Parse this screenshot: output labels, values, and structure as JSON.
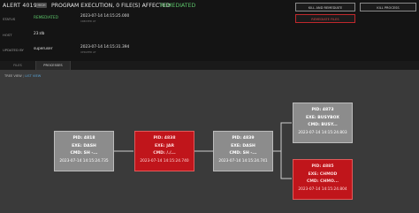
{
  "header": {
    "alert_id": "ALERT 40196",
    "severity_badge": "HIGH",
    "title": "PROGRAM EXECUTION, 0 FILE(S) AFFECTED",
    "status": "REMEDIATED"
  },
  "fields": {
    "status": {
      "label": "STATUS",
      "value": "REMEDIATED"
    },
    "host": {
      "label": "HOST",
      "value": "23:db"
    },
    "updated_by": {
      "label": "UPDATED BY",
      "value": "superuser"
    },
    "created": {
      "value": "2023-07-14 14:15:25.000",
      "sub": "CREATED AT"
    },
    "updated": {
      "value": "2023-07-14 14:15:31.394",
      "sub": "UPDATED AT"
    }
  },
  "actions": {
    "kill_and_remediate": "KILL AND REMEDIATE",
    "kill_process": "KILL PROCESS",
    "remediate_files": "REMEDIATE FILES"
  },
  "tabs": [
    {
      "label": "FILES"
    },
    {
      "label": "PROCESSES"
    }
  ],
  "view": {
    "tree_label": "TREE VIEW",
    "separator": "|",
    "list_label": "LIST VIEW"
  },
  "nodes": [
    {
      "pid": "PID: 4818",
      "exe": "EXE: DASH",
      "cmd": "CMD: SH -...",
      "time": "2023-07-14 14:15:24.735"
    },
    {
      "pid": "PID: 4838",
      "exe": "EXE: JAR",
      "cmd": "CMD: /./...",
      "time": "2023-07-14 14:15:24.740"
    },
    {
      "pid": "PID: 4839",
      "exe": "EXE: DASH",
      "cmd": "CMD: SH -...",
      "time": "2023-07-14 14:15:24.741"
    },
    {
      "pid": "PID: 4873",
      "exe": "EXE: BUSYBOX",
      "cmd": "CMD: BUSY...",
      "time": "2023-07-14 14:15:24.803"
    },
    {
      "pid": "PID: 4885",
      "exe": "EXE: CHMOD",
      "cmd": "CMD: CHMO...",
      "time": "2023-07-14 14:15:24.804"
    }
  ],
  "colors": {
    "remediated_green": "#5cc46a",
    "malicious_red": "#c0151b",
    "node_gray": "#8c8c8c",
    "link_blue": "#5aa6d9"
  }
}
